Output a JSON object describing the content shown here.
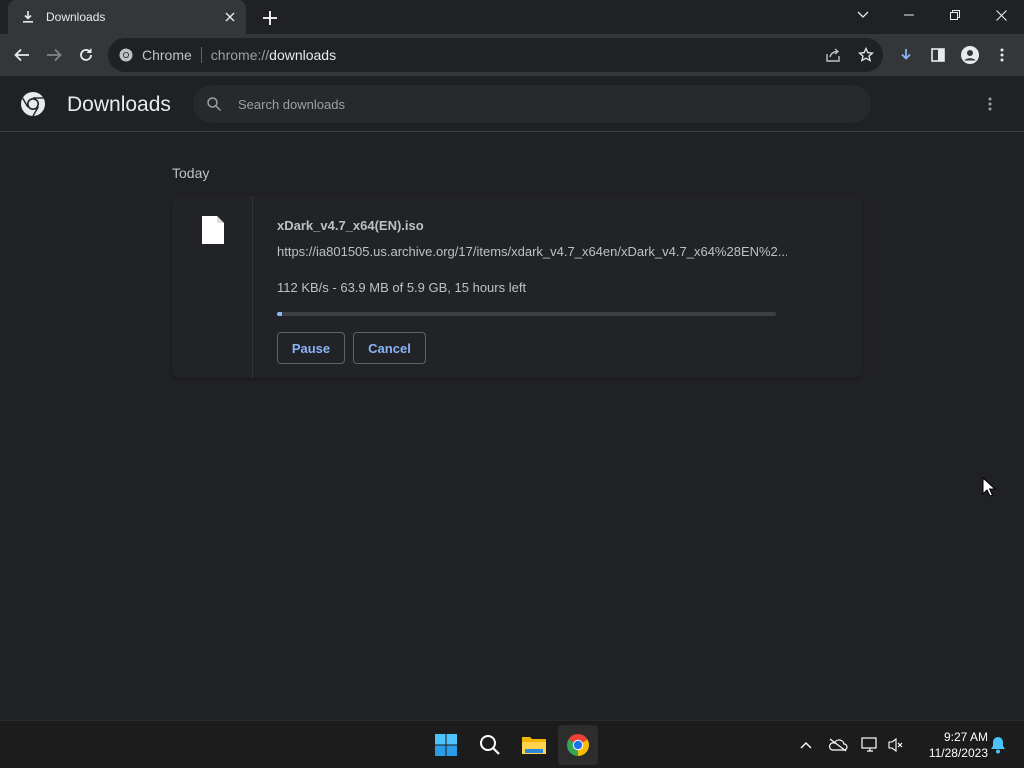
{
  "tab": {
    "title": "Downloads"
  },
  "toolbar": {
    "site_chip": "Chrome",
    "url_prefix": "chrome://",
    "url_host": "downloads"
  },
  "downloads_page": {
    "title": "Downloads",
    "search_placeholder": "Search downloads",
    "date_group": "Today",
    "item": {
      "filename": "xDark_v4.7_x64(EN).iso",
      "url": "https://ia801505.us.archive.org/17/items/xdark_v4.7_x64en/xDark_v4.7_x64%28EN%2...",
      "status": "112 KB/s - 63.9 MB of 5.9 GB, 15 hours left",
      "progress_fraction": 0.011,
      "pause_label": "Pause",
      "cancel_label": "Cancel"
    }
  },
  "taskbar": {
    "apps": [
      "windows-start",
      "search",
      "file-explorer",
      "chrome"
    ],
    "time": "9:27 AM",
    "date": "11/28/2023"
  },
  "colors": {
    "accent": "#8ab4f8",
    "background": "#202124",
    "toolbar": "#35363a"
  }
}
